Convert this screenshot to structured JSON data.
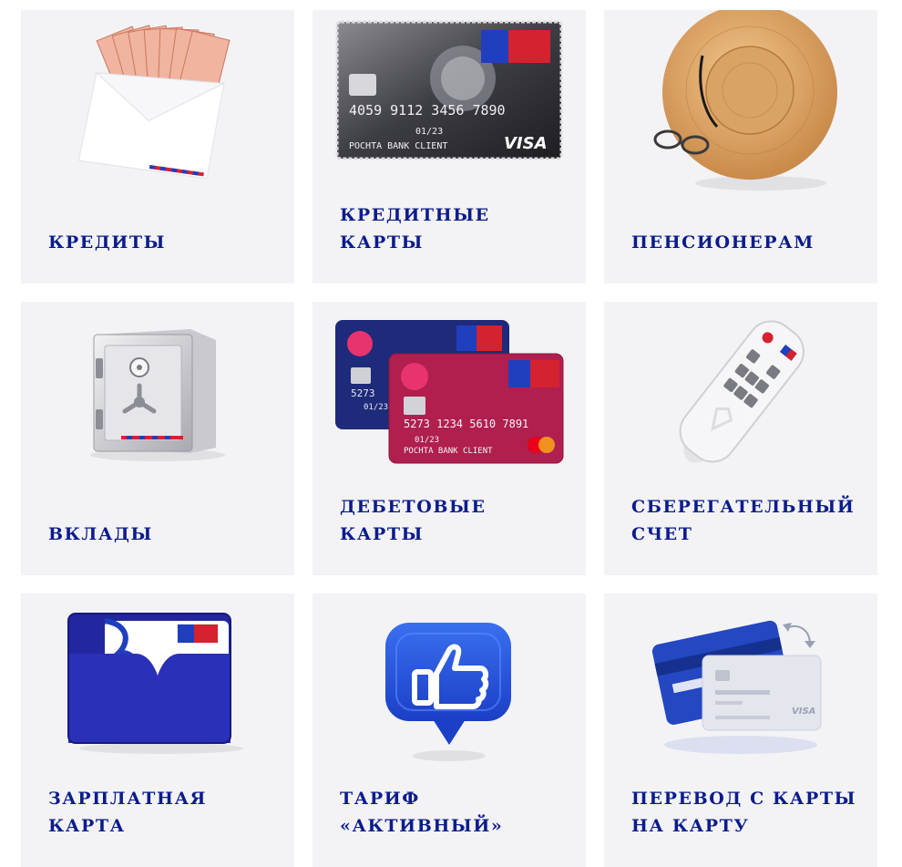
{
  "tiles": [
    {
      "id": "credits",
      "label": "КРЕДИТЫ",
      "icon": "envelope-money-icon"
    },
    {
      "id": "credit-cards",
      "label": "КРЕДИТНЫЕ КАРТЫ",
      "icon": "credit-card-icon",
      "card_number": "4059 9112 3456 7890",
      "card_expiry": "01/23",
      "card_holder": "POCHTA BANK CLIENT",
      "card_brand": "VISA",
      "bank_logo": "ПОЧТА БАНК"
    },
    {
      "id": "pensioners",
      "label": "ПЕНСИОНЕРАМ",
      "icon": "straw-hat-icon"
    },
    {
      "id": "deposits",
      "label": "ВКЛАДЫ",
      "icon": "safe-icon"
    },
    {
      "id": "debit-cards",
      "label": "ДЕБЕТОВЫЕ КАРТЫ",
      "icon": "debit-cards-icon",
      "card_number": "5273 1234 5610 7891",
      "card_number_short": "5273",
      "card_expiry": "01/23",
      "card_holder": "POCHTA BANK CLIENT",
      "bank_logo": "ПОЧТА БАНК"
    },
    {
      "id": "savings-account",
      "label": "СБЕРЕГАТЕЛЬНЫЙ\nСЧЕТ",
      "icon": "remote-control-icon"
    },
    {
      "id": "salary-card",
      "label": "ЗАРПЛАТНАЯ КАРТА",
      "icon": "card-wallet-icon",
      "bank_logo": "ПОЧТА БАНК"
    },
    {
      "id": "active-tariff",
      "label": "ТАРИФ\n«АКТИВНЫЙ»",
      "icon": "thumbs-up-icon"
    },
    {
      "id": "card-transfer",
      "label": "ПЕРЕВОД С КАРТЫ\nНА КАРТУ",
      "icon": "card-transfer-icon",
      "card_brand": "VISA"
    }
  ],
  "colors": {
    "tile_bg": "#f3f3f6",
    "label": "#0b1c8c",
    "brand_red": "#d5222f",
    "accent_blue": "#1f3fbf"
  }
}
